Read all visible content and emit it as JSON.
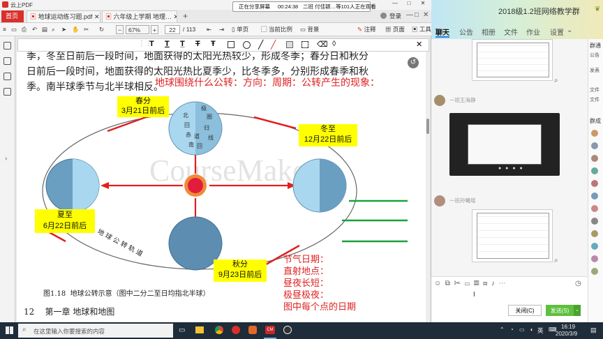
{
  "pdf": {
    "app_title": "云上PDF",
    "tabs": [
      {
        "label": "首页"
      },
      {
        "label": "地球运动练习题.pdf"
      },
      {
        "label": "六年级上学期 地理…"
      }
    ],
    "top_links": {
      "login": "登录"
    },
    "toolbar": {
      "zoom": "67%",
      "page_current": "22",
      "page_total": "/ 113",
      "single_page": "单页",
      "current_ratio": "当前比例",
      "background": "背景",
      "annotate": "注释",
      "page": "页面",
      "tools": "工具"
    },
    "page_text": {
      "line1": "季，冬至日前后一段时间，地面获得的太阳光热较少，形成冬季；春分日和秋分",
      "line2": "日前后一段时间，地面获得的太阳光热比夏季少，比冬季多，分别形成春季和秋",
      "line3": "季。南半球季节与北半球相反。",
      "red_question": "地球围绕什么公转：方向：周期：公转产生的现象：",
      "watermark": "CourseMaker",
      "spring_label": "春分",
      "spring_date": "3月21日前后",
      "winter_label": "冬至",
      "winter_date": "12月22日前后",
      "summer_label": "夏至",
      "summer_date": "6月22日前后",
      "autumn_label": "秋分",
      "autumn_date": "9月23日前后",
      "orbit_label": "地球公转轨道",
      "globe_lines": [
        "北",
        "回",
        "赤",
        "道",
        "南",
        "回",
        "归",
        "极",
        "线",
        "圈"
      ],
      "notes": [
        "节气日期：",
        "直射地点：",
        "昼夜长短：",
        "极昼极夜：",
        "图中每个点的日期"
      ],
      "caption_fig": "图1.18",
      "caption_text": "地球公转示意（图中二分二至日均指北半球）",
      "page_no": "12",
      "chapter": "第一章  地球和地图"
    }
  },
  "share_banner": {
    "status": "正在分享屏幕",
    "time": "00:24:38",
    "viewers": "二班 付佳颖…等101人正在观看"
  },
  "chat": {
    "group_title": "2018级1.2班网络教学群",
    "tabs": [
      "聊天",
      "公告",
      "相册",
      "文件",
      "作业",
      "设置"
    ],
    "messages": [
      {
        "sender": "一班王海静"
      },
      {
        "sender": "一班孙曦瑶"
      }
    ],
    "side_labels": [
      "群通",
      "公告",
      "发表",
      "文件",
      "文件",
      "群成"
    ],
    "close_label": "关闭(C)",
    "send_label": "发送(S)"
  },
  "taskbar": {
    "search_placeholder": "在这里输入你要搜索的内容",
    "time": "16:19",
    "date": "2020/3/9",
    "ime": "英"
  },
  "colors": {
    "accent_red": "#d9302c",
    "label_yellow": "#ffff00",
    "arrow_red": "#e02020",
    "orbit_green": "#1aa13a",
    "send_green": "#5fbf3f"
  }
}
